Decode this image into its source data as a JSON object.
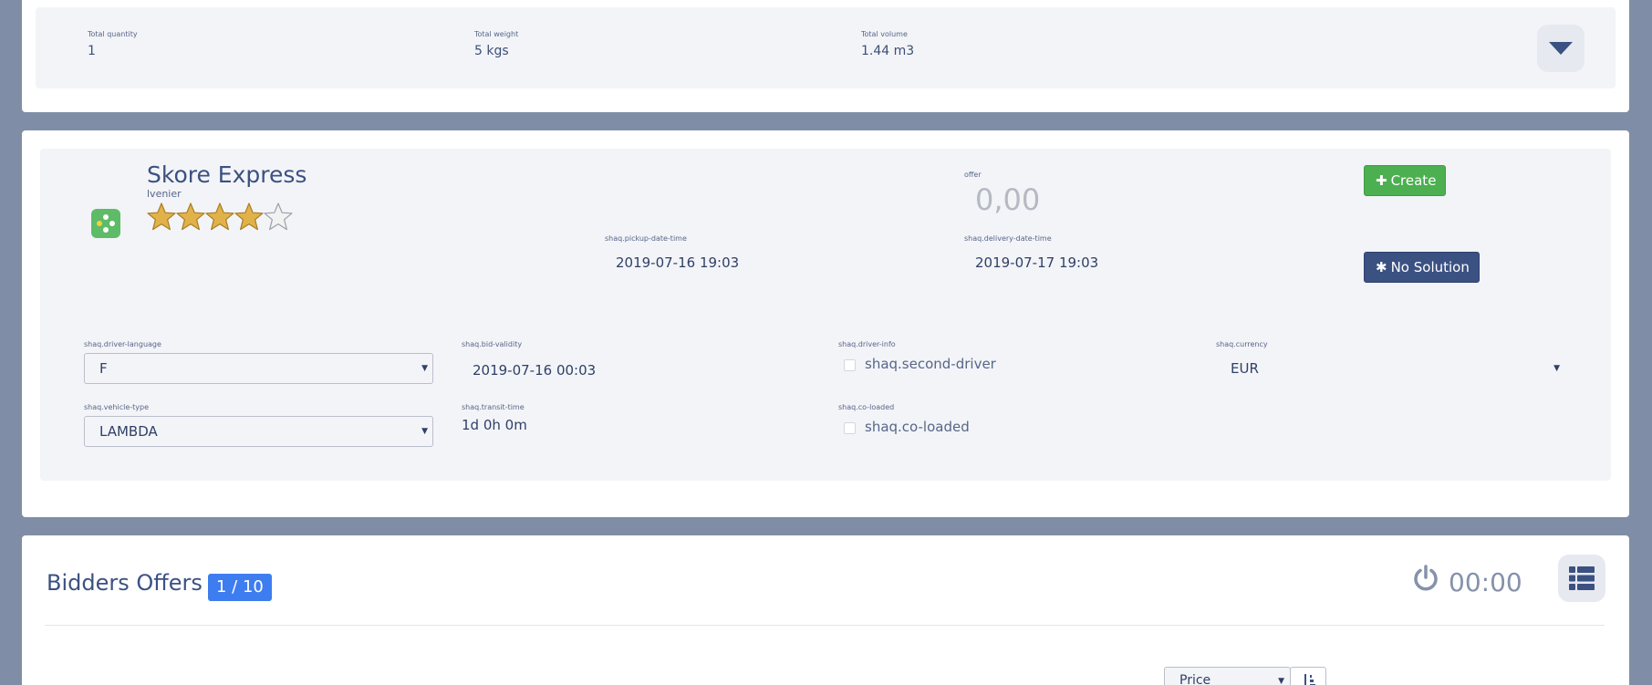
{
  "summary": {
    "total_quantity_label": "Total quantity",
    "total_quantity": "1",
    "total_weight_label": "Total weight",
    "total_weight": "5 kgs",
    "total_volume_label": "Total volume",
    "total_volume": "1.44 m3"
  },
  "carrier": {
    "name": "Skore Express",
    "contact": "lvenier",
    "rating": 4,
    "rating_max": 5,
    "logo_icon": "clover-dots-icon",
    "offer_label": "offer",
    "offer_value": "0,00",
    "pickup_label": "shaq.pickup-date-time",
    "pickup_value": "2019-07-16 19:03",
    "delivery_label": "shaq.delivery-date-time",
    "delivery_value": "2019-07-17 19:03",
    "create_label": "Create",
    "no_solution_label": "No Solution",
    "driver_language_label": "shaq.driver-language",
    "driver_language_value": "F",
    "bid_validity_label": "shaq.bid-validity",
    "bid_validity_value": "2019-07-16 00:03",
    "driver_info_label": "shaq.driver-info",
    "second_driver_label": "shaq.second-driver",
    "currency_label": "shaq.currency",
    "currency_value": "EUR",
    "vehicle_type_label": "shaq.vehicle-type",
    "vehicle_type_value": "LAMBDA",
    "transit_time_label": "shaq.transit-time",
    "transit_time_value": "1d 0h 0m",
    "co_loaded_label": "shaq.co-loaded",
    "co_loaded_checkbox_label": "shaq.co-loaded"
  },
  "bidders": {
    "title": "Bidders Offers",
    "badge": "1 / 10",
    "timer": "00:00",
    "sort_select_value": "Price"
  },
  "colors": {
    "background": "#7f8ea6",
    "primary": "#3b5182",
    "success": "#4caf50",
    "badge": "#3e7df0",
    "star_fill": "#e2b24a",
    "panel": "#f3f4f7"
  }
}
